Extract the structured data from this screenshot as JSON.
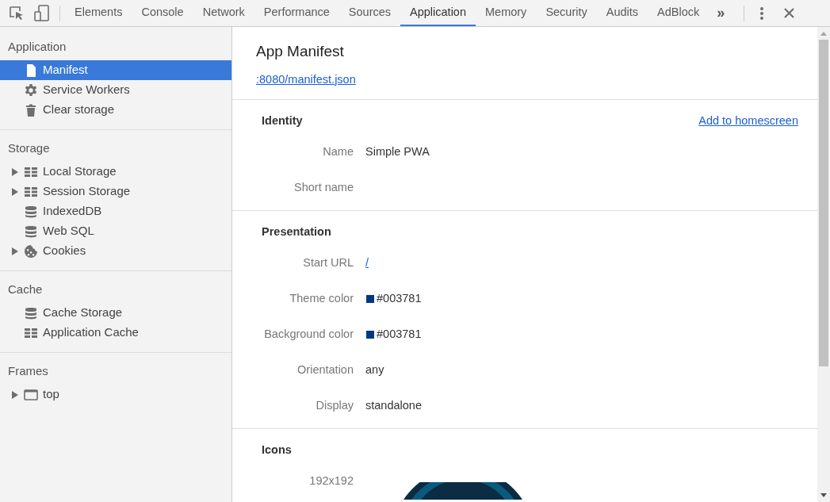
{
  "toolbar": {
    "tabs": [
      {
        "label": "Elements",
        "selected": false
      },
      {
        "label": "Console",
        "selected": false
      },
      {
        "label": "Network",
        "selected": false
      },
      {
        "label": "Performance",
        "selected": false
      },
      {
        "label": "Sources",
        "selected": false
      },
      {
        "label": "Application",
        "selected": true
      },
      {
        "label": "Memory",
        "selected": false
      },
      {
        "label": "Security",
        "selected": false
      },
      {
        "label": "Audits",
        "selected": false
      },
      {
        "label": "AdBlock",
        "selected": false
      }
    ],
    "overflow": "»"
  },
  "sidebar": {
    "sections": [
      {
        "title": "Application",
        "items": [
          {
            "label": "Manifest",
            "kind": "file",
            "expandable": false,
            "selected": true
          },
          {
            "label": "Service Workers",
            "kind": "gear",
            "expandable": false,
            "selected": false
          },
          {
            "label": "Clear storage",
            "kind": "trash",
            "expandable": false,
            "selected": false
          }
        ]
      },
      {
        "title": "Storage",
        "items": [
          {
            "label": "Local Storage",
            "kind": "grid",
            "expandable": true,
            "selected": false
          },
          {
            "label": "Session Storage",
            "kind": "grid",
            "expandable": true,
            "selected": false
          },
          {
            "label": "IndexedDB",
            "kind": "database",
            "expandable": false,
            "selected": false
          },
          {
            "label": "Web SQL",
            "kind": "database",
            "expandable": false,
            "selected": false
          },
          {
            "label": "Cookies",
            "kind": "cookie",
            "expandable": true,
            "selected": false
          }
        ]
      },
      {
        "title": "Cache",
        "items": [
          {
            "label": "Cache Storage",
            "kind": "database",
            "expandable": false,
            "selected": false
          },
          {
            "label": "Application Cache",
            "kind": "grid",
            "expandable": false,
            "selected": false
          }
        ]
      },
      {
        "title": "Frames",
        "items": [
          {
            "label": "top",
            "kind": "frame",
            "expandable": true,
            "selected": false
          }
        ]
      }
    ]
  },
  "main": {
    "title": "App Manifest",
    "manifest_link": ":8080/manifest.json",
    "sections": [
      {
        "title": "Identity",
        "action": "Add to homescreen",
        "rows": [
          {
            "label": "Name",
            "kind": "text",
            "value": "Simple PWA"
          },
          {
            "label": "Short name",
            "kind": "text"
          }
        ]
      },
      {
        "title": "Presentation",
        "rows": [
          {
            "label": "Start URL",
            "kind": "link",
            "value": "/"
          },
          {
            "label": "Theme color",
            "kind": "color",
            "value": "#003781",
            "color": "#003781"
          },
          {
            "label": "Background color",
            "kind": "color",
            "value": "#003781",
            "color": "#003781"
          },
          {
            "label": "Orientation",
            "kind": "text",
            "value": "any"
          },
          {
            "label": "Display",
            "kind": "text",
            "value": "standalone"
          }
        ]
      },
      {
        "title": "Icons",
        "rows": [
          {
            "label": "192x192",
            "kind": "image"
          }
        ]
      }
    ]
  }
}
